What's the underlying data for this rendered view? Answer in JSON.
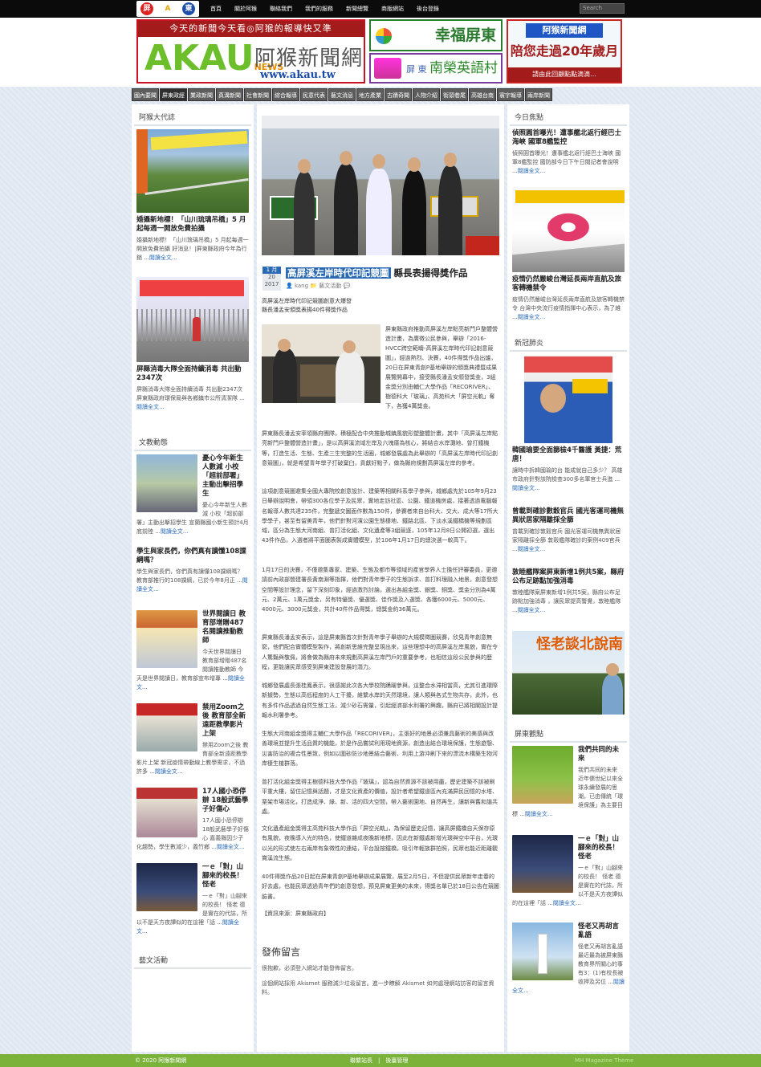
{
  "topnav": {
    "logo_letter": "A",
    "items": [
      "首頁",
      "關於阿猴",
      "聯絡我們",
      "我們的服務",
      "新聞總覽",
      "商版網站",
      "後台登錄"
    ],
    "search_placeholder": "Search"
  },
  "banners": {
    "main_slogan": "今天的新聞今天看◎阿猴的報導快又準",
    "main_logo": "AKAU",
    "main_logo_news": "NEWS",
    "main_name": "阿猴新聞網",
    "main_url": "www.akau.tw",
    "fortune": "幸福屏東",
    "eng_small": "屏 東",
    "eng_main": "南榮英語村",
    "twenty_top": "阿猴新聞網",
    "twenty_mid": "陪您走過20年歲月",
    "twenty_bottom": "請由此回顧點點滴滴..."
  },
  "categories": [
    "國內要聞",
    "屏東政經",
    "業政新聞",
    "真溝新聞",
    "社會新聞",
    "綜合報導",
    "民意代表",
    "藝文消息",
    "地方產業",
    "古蹟奇聞",
    "人物介紹",
    "街頭巷尾",
    "高雄台南",
    "寰宇報導",
    "兩岸新聞"
  ],
  "left": {
    "widget1_title": "阿猴大代誌",
    "posts": [
      {
        "title": "婚攝新地標！「山川琉璃吊橋」5 月起每週一開放免費拍攝",
        "excerpt": "婚攝新地標！「山川琉璃吊橋」5 月起每週一開放免費拍攝 好消息！|屏東縣政府今年為行銷 ...",
        "more": "閱讀全文..."
      },
      {
        "title": "屏縣消毒大隊全面持續消毒 共出動2347次",
        "excerpt": "屏縣消毒大隊全面持續消毒 共出動2347次 屏東縣政府環保局與各鄉鎮市公所清潔隊 ...",
        "more": "閱讀全文..."
      }
    ],
    "widget2_title": "文教動態",
    "edu": [
      {
        "title": "憂心今年新生人數減 小校「超前部署」主動出擊招學生",
        "excerpt": "憂心今年新生人數減 小校「超前部署」主動出擊招學生 宣蘭縣國小新生預計4月底前陸 ...",
        "more": "閱讀全文..."
      },
      {
        "title": "學生與家長們，你們真有讀懂108課綱嗎？",
        "excerpt": "學生與家長們，你們真有讀懂108課綱嗎？ 教育部推行的108課綱，已於今年8月正 ...",
        "more": "閱讀全文..."
      },
      {
        "title": "世界閱讀日 教育部增贈487名閱讀推動教師",
        "excerpt": "今天世界閱讀日 教育部增贈487名閱讀推動教師 今天是世界閱讀日，教育部宣布增專 ...",
        "more": "閱讀全文..."
      },
      {
        "title": "禁用Zoom之後 教育部全新遠距教學影片上架",
        "excerpt": "禁用Zoom之後 教育部全新遠距教學影片上架 新冠疫情帶動線上教學需求，不過許多 ...",
        "more": "閱讀全文..."
      },
      {
        "title": "17人國小恐停辦 18般武藝學子好傷心",
        "excerpt": "17人國小恐停辦 18般武藝學子好傷心 嘉義縣因少子化趨勢，學生數減少，義竹鄉 ...",
        "more": "閱讀全文..."
      },
      {
        "title": "一ｅ「對」山腳來的校長！怪老",
        "excerpt": "一ｅ「對」山腳來的校長！ 怪老 德是實在的代誌，所以不是天方夜譚似的在這裡「話 ...",
        "more": "閱讀全文..."
      }
    ],
    "widget3_title": "藝文活動"
  },
  "article": {
    "date_month": "1 月",
    "date_day": "20",
    "date_year": "2017",
    "title_highlight": "高屏溪左岸時代印記競圖",
    "title_rest": "縣長表揚得獎作品",
    "author": "kang",
    "category": "藝文活動",
    "subhead": "高屏溪左岸時代印記競圖創意大爆發\n縣長潘孟安頒獎表揚40件得獎作品",
    "intro": "屏東縣政府推動高屏溪左岸點亮新門戶整體營造計畫，為廣徵公民參與，舉辦「2016-HVCC跨空範疇-高屏溪左岸時代印記創意競圖」，經過熱烈、決賽，40件得獎作品出爐，20日在屏東青創P基地舉辦的頒獎典禮暨成果展覽開幕中，接受縣長潘孟安頒發獎金，3組金獎分別由輔仁大學作品「RECORIVER」、樹德科大「玻璃」、高苑科大「屏空光軌」奪下，各獲4萬獎金。",
    "paragraphs": [
      "屏東縣長潘孟安率領縣府團隊，積極配合中央推動城鎮風貌形塑整體計畫，其中「高屏溪左岸點亮新門戶整體營造計畫」，是以高屏溪流域左岸及六塊厝為核心，將結合水岸灘地、曾打鐵機等，打造生活、生態、生產三生完整的生活圈，城鄉發展處為此舉辦的「高屏溪左岸時代印記創意競圖」，就是希望青年學子打破窠臼，貢獻好點子，做為縣府規劃高屏溪左岸的參考。",
      "這項創意競圖邀集全國大專院校創意設計、建築等相關科系學子參與，城鄉處先於105年9月23日舉辦說明會，帶領300各位學子及民眾，實地走訪社區、公園、鐵道機房處，接著透過電腦報名報導人數共達235件，完整遞交圖面作數為150件，參賽者來自台科大、交大、成大等17所大學學子，甚至有留美青年，他們針對河濱公園生態棲地、鐵路北區、下淡水溪鐵橋機等規劃區域，區分為生態大河南組、曾打活化組、文化遺產等3組競逐，105年12月8日公開初選，選出43件作品，入選者將平面圖表製成實體模型，於106年1月17日的總決選一較高下。",
      "1月17日的決賽，不僅邀集專家、建築、生態及都市等領域的產官學界人士擔任評審委員，更邀請前內政部營建署長黃南淵等指揮，他們對青年學子的生態訴求、曾打料理融入地景，創意發想空間等設計理念，留下深刻印象，經過激烈討論，選出各組金獎、銀獎、銅獎、獎金分別為4萬元、2萬元、1萬元獎金，另有特優獎、優選獎、佳作獎及入選獎、各獲6000元、5000元、4000元、3000元獎金，共計40件作品得獎，總獎金約36萬元。",
      "屏東縣長潘孟安表示，這是屏東縣首次針對青年學子舉辦的大規模徵圖競賽，欣見青年創意無窮，他們配合實體模型製作，將創新思維完整呈現出來，這些理想中的高屏溪左岸風貌，實在令人驚豔與敬佩，將會做為縣府未來規劃高屏溪左岸門戶的重要參考，也相信這段公民參與的歷程，更能讓民眾感受到屏東建設發展的潛力。",
      "城鄉發展處長張桂鳳表示，很感謝此次各大學校院踴躍參與，這整合水滞相當高，尤其引進環際新據勢，生態以高低程度的人工干擾，維繫水岸的天然環境，讓人類與各式生物共存，此外，也有多件作品透過自然生態工法，減少砂石需量，引起經濟部水利署的興趣，縣府已將相關設計提報水利署參考。",
      "生態大河南組金獎得主輔仁大學作品「RECORIVER」，主張好的地景必須兼具藝術的美感與改善環境並提升生活品質的機能，於是作品嘗試利用現地資源，創造出結合環境保護，生態遊憩、災害防治的複合性景致，例如以圍砂防沙地景結合藝術、利用上游沖刷下來的漂流木構築生物河岸棲生植群落。",
      "曾打活化組金獎得主樹德科技大學作品「玻璃」，認為自然資源不該被用盡，歷史建築不該被刷平重大樓，留住記憶與話題，才是文化資產的價值，設計者希望鐵道區內充滿屏民回憶的水塔、栗架市場活化，打造成淨、綠、新、活的四大空間，帶入藝術園地、自然再生，讓新與舊和諧共處。",
      "文化遺產組金獎得主高苑科技大學作品「屏空光軌」，為保留歷史記憶，讓高屏鐵橋自天保存原有風貌，夜晚導入光的特色，使鐵道雜成夜晚新地標，因此在新鐵處新增光環與空中平台，光環以光的形式使左右兩岸有象徵性的連結，平台設按鐵橋，吸引年輕族群拍照，民眾也能近距離觀賞溪流生態。",
      "40件得獎作品20日起在屏東青創P基地舉辦成果展覽，展至2月5日，不但提供民眾新年走春的好去處，也能民眾透過青年們的創意發想，預見屏東更美的未來，得獎名單已於18日公告在競圖臉書。",
      "【資訊來源：屏東縣政府】"
    ],
    "comment_heading": "發佈留言",
    "comment_text1": "很抱歉，必須登入網站才能發佈留言。",
    "comment_text2": "這個網站採用 Akismet 服務減少垃圾留言。進一步瞭解 Akismet 如何處理網站訪客的留言資料。"
  },
  "right": {
    "widget1_title": "今日焦點",
    "focus": [
      {
        "title": "偵照圓首曝光！遭事艦北返行經巴士海峽 國軍8艦監控",
        "excerpt": "偵照圓首曝光！遭事艦北返行經巴士海峽 國軍8艦監控 國防部今日下午日閱記者會說明 ...",
        "more": "閱讀全文..."
      },
      {
        "title": "疫情仍然嚴峻台灣延長兩岸直航及旅客轉機禁令",
        "excerpt": "疫情仍然嚴峻台灣延長兩岸直航及旅客轉機禁令 台灣中央流行疫情指揮中心表示，為了維 ...",
        "more": "閱讀全文..."
      }
    ],
    "widget2_title": "新冠肺炎",
    "covid": [
      {
        "title": "韓國瑜要全面篩檢4千醫護 黃捷：荒唐！",
        "excerpt": "讓時中拆韓國瑜的台 能成就自己多少？ 高雄市政府針對該院檢查300多名軍官士兵進 ...",
        "more": "閱讀全文..."
      },
      {
        "title": "曾載到確診數穀官兵 國光客運司機無異狀居家隔離採全篩",
        "excerpt": "曾載到確診敦穀官兵 國光客運司機無異狀居家隔離採全篩 敦穀艦隊確診的案例409官兵 ...",
        "more": "閱讀全文..."
      },
      {
        "title": "敦睦艦隊案屏東新增1例共5案，縣府公布足跡點加強消毒",
        "excerpt": "敦睦艦隊案屏東新增1例共5案，縣府公布足跡點加強消毒 ，讓民眾提高警覺，敦睦艦隊 ...",
        "more": "閱讀全文..."
      }
    ],
    "promo_text": "怪老談北說南",
    "widget3_title": "屏東觀點",
    "views": [
      {
        "title": "我們共同的未來",
        "excerpt": "我們共同的未來 近年儒世紀以來全球永續發展的思潮，已由傳統「環境保護」為主要目標 ...",
        "more": "閱讀全文..."
      },
      {
        "title": "一ｅ「對」山腳來的校長！ 怪老",
        "excerpt": "一ｅ「對」山腳來的校長！ 怪老 德是實在的代誌，所以不是天方夜譚似的在這裡「話 ...",
        "more": "閱讀全文..."
      },
      {
        "title": "怪老又再胡言亂語",
        "excerpt": "怪老又再胡言亂語 最近最為被屏東縣教育界所關心的事有3：(1)有校長被收押及另位 ...",
        "more": "閱讀全文..."
      }
    ]
  },
  "footer": {
    "copyright": "© 2020 阿猴新聞網",
    "links": "聯繫站長　|　後臺管理",
    "theme": "MH Magazine Theme"
  }
}
